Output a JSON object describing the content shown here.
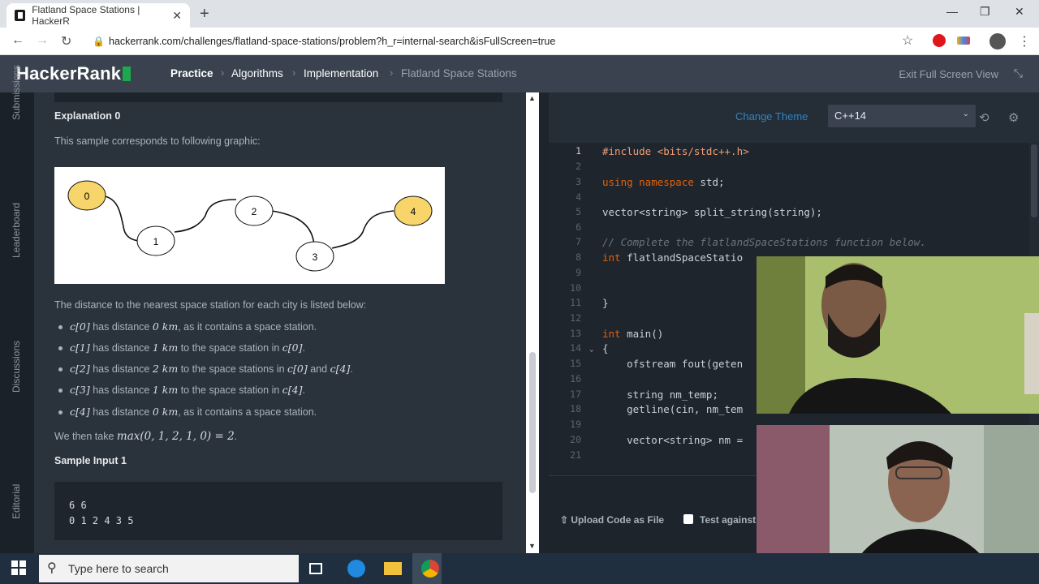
{
  "browser": {
    "tab_title": "Flatland Space Stations | HackerR",
    "tab_close": "✕",
    "new_tab": "+",
    "url": "hackerrank.com/challenges/flatland-space-stations/problem?h_r=internal-search&isFullScreen=true",
    "window": {
      "minimize": "—",
      "maximize": "❐",
      "close": "✕"
    }
  },
  "header": {
    "logo": "HackerRank",
    "breadcrumb": [
      "Practice",
      "Algorithms",
      "Implementation",
      "Flatland Space Stations"
    ],
    "exit_fullscreen": "Exit Full Screen View"
  },
  "side_tabs": [
    "Submissions",
    "Leaderboard",
    "Discussions",
    "Editorial"
  ],
  "problem": {
    "explanation_title": "Explanation 0",
    "intro": "This sample corresponds to following graphic:",
    "graph_nodes": [
      "0",
      "1",
      "2",
      "3",
      "4"
    ],
    "distances_intro": "The distance to the nearest space station for each city is listed below:",
    "bullets": [
      {
        "c": "c[0]",
        "mid": " has distance ",
        "d": "0 km",
        "tail": ", as it contains a space station."
      },
      {
        "c": "c[1]",
        "mid": " has distance ",
        "d": "1 km",
        "tail": " to the space station in ",
        "ref": "c[0]",
        "end": "."
      },
      {
        "c": "c[2]",
        "mid": " has distance ",
        "d": "2 km",
        "tail": " to the space stations in ",
        "ref": "c[0]",
        "and": " and ",
        "ref2": "c[4]",
        "end": "."
      },
      {
        "c": "c[3]",
        "mid": " has distance ",
        "d": "1 km",
        "tail": " to the space station in ",
        "ref": "c[4]",
        "end": "."
      },
      {
        "c": "c[4]",
        "mid": " has distance ",
        "d": "0 km",
        "tail": ", as it contains a space station."
      }
    ],
    "conclusion_pre": "We then take ",
    "conclusion_math": "max(0, 1, 2, 1, 0) = 2",
    "conclusion_post": ".",
    "sample_title": "Sample Input 1",
    "sample_lines": [
      "6 6",
      "0 1 2 4 3 5"
    ]
  },
  "editor": {
    "change_theme": "Change Theme",
    "language": "C++14",
    "line_numbers": [
      "1",
      "2",
      "3",
      "4",
      "5",
      "6",
      "7",
      "8",
      "9",
      "10",
      "11",
      "12",
      "13",
      "14",
      "15",
      "16",
      "17",
      "18",
      "19",
      "20",
      "21"
    ],
    "lines": {
      "l1": "#include <bits/stdc++.h>",
      "l3a": "using namespace",
      "l3b": " std;",
      "l5": "vector<string> split_string(string);",
      "l7": "// Complete the flatlandSpaceStations function below.",
      "l8a": "int",
      "l8b": " flatlandSpaceStatio",
      "l11": "}",
      "l13a": "int",
      "l13b": " main()",
      "l14": "{",
      "l15": "    ofstream fout(geten",
      "l17": "    string nm_temp;",
      "l18": "    getline(cin, nm_tem",
      "l20": "    vector<string> nm ="
    },
    "upload": "Upload Code as File",
    "test_against": "Test against"
  },
  "taskbar": {
    "search_placeholder": "Type here to search"
  }
}
